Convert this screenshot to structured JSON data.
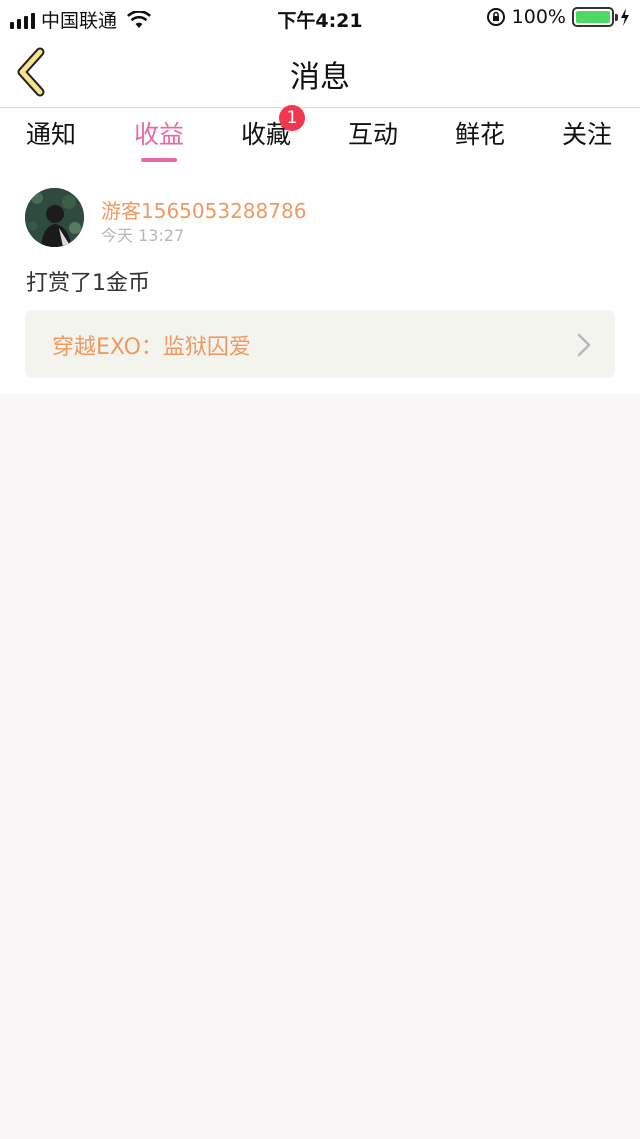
{
  "status_bar": {
    "carrier": "中国联通",
    "time": "下午4:21",
    "battery": "100%",
    "battery_fill": 1.0
  },
  "nav": {
    "title": "消息",
    "back_icon": "chevron-left-icon"
  },
  "tabs": {
    "items": [
      {
        "label": "通知"
      },
      {
        "label": "收益"
      },
      {
        "label": "收藏"
      },
      {
        "label": "互动"
      },
      {
        "label": "鲜花"
      },
      {
        "label": "关注"
      }
    ],
    "active_label": "收益",
    "badge_count": "1"
  },
  "message": {
    "username": "游客1565053288786",
    "time": "今天 13:27",
    "text": "打赏了1金币",
    "book_title": "穿越EXO：监狱囚爱"
  },
  "colors": {
    "accent": "#e86aa4",
    "username": "#f09a63",
    "badge": "#f2384e",
    "back_icon": "#f7e38a"
  }
}
